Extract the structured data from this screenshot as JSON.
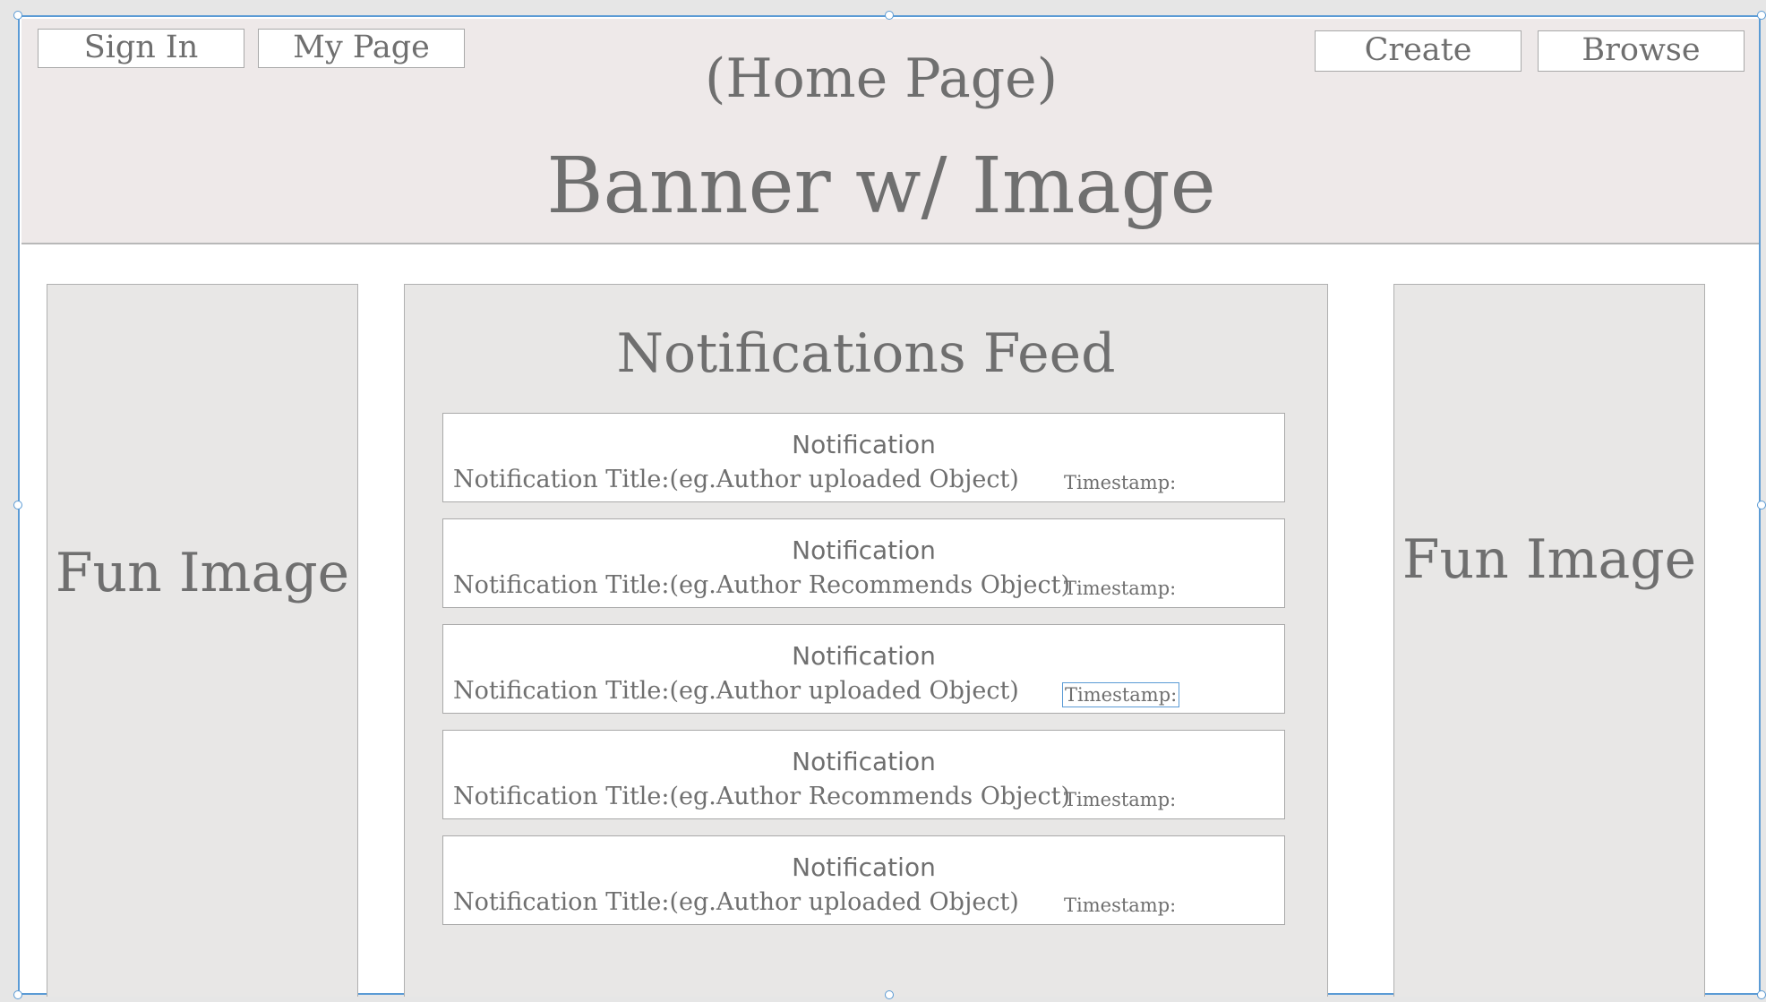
{
  "header": {
    "sign_in_label": "Sign In",
    "my_page_label": "My Page",
    "page_label": "(Home Page)",
    "create_label": "Create",
    "browse_label": "Browse",
    "banner_text": "Banner w/ Image"
  },
  "left_panel": {
    "label": "Fun Image"
  },
  "right_panel": {
    "label": "Fun Image"
  },
  "feed": {
    "title": "Notifications Feed",
    "items": [
      {
        "heading": "Notification",
        "title": "Notification Title:(eg.Author uploaded Object)",
        "timestamp": "Timestamp:"
      },
      {
        "heading": "Notification",
        "title": "Notification Title:(eg.Author Recommends Object)",
        "timestamp": "Timestamp:"
      },
      {
        "heading": "Notification",
        "title": "Notification Title:(eg.Author uploaded Object)",
        "timestamp": "Timestamp:"
      },
      {
        "heading": "Notification",
        "title": "Notification Title:(eg.Author Recommends Object)",
        "timestamp": "Timestamp:"
      },
      {
        "heading": "Notification",
        "title": "Notification Title:(eg.Author uploaded Object)",
        "timestamp": "Timestamp:"
      }
    ]
  },
  "colors": {
    "selection": "#5b9bd5",
    "banner_bg": "#eee9e9",
    "panel_bg": "#e8e7e6",
    "text": "#6f6f6f"
  }
}
